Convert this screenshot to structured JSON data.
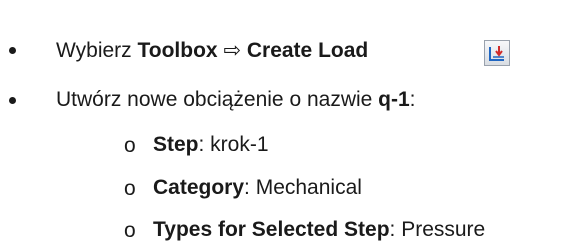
{
  "items": [
    {
      "prefix": "Wybierz ",
      "bold1": "Toolbox",
      "arrow": " ⇨ ",
      "bold2": "Create Load",
      "icon": "create-load-icon"
    },
    {
      "prefix": "Utwórz nowe obciążenie o nazwie ",
      "bold": "q-1",
      "suffix": ":"
    }
  ],
  "subitems": [
    {
      "label": "Step",
      "value": ": krok-1"
    },
    {
      "label": "Category",
      "value": ": Mechanical"
    },
    {
      "label": "Types for Selected Step",
      "value": ": Pressure"
    }
  ],
  "subbullet_marker": "o"
}
